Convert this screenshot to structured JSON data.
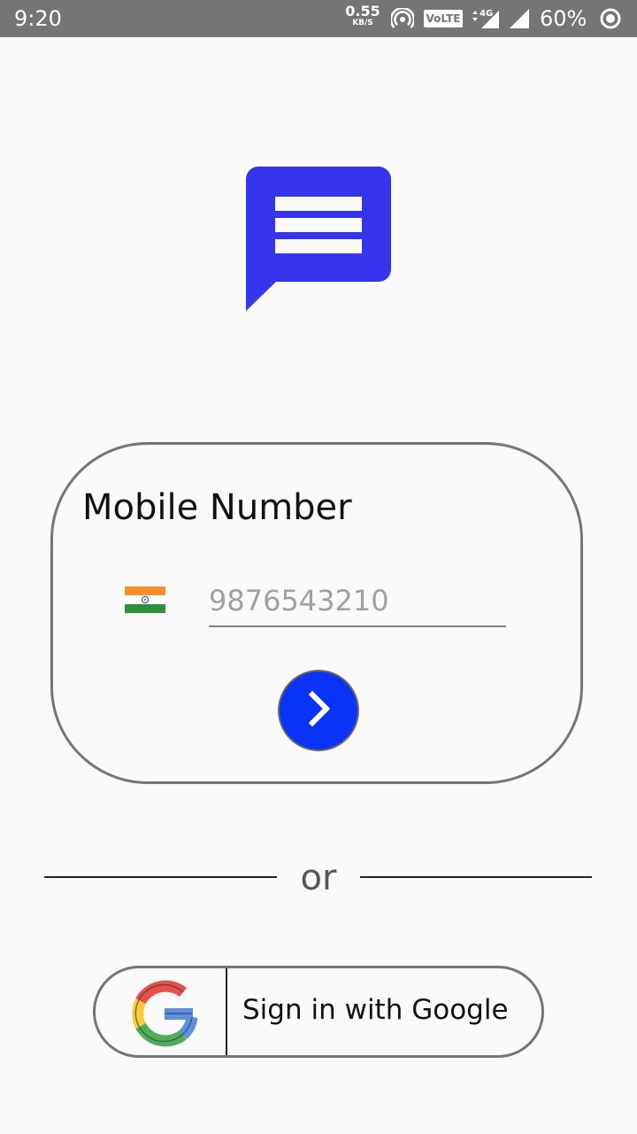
{
  "status_bar": {
    "time": "9:20",
    "net_speed_value": "0.55",
    "net_speed_unit": "KB/S",
    "volte_label": "VoLTE",
    "network_label": "4G",
    "battery_percent": "60%",
    "icons": [
      "hotspot-icon",
      "signal-4g-icon",
      "signal-icon",
      "battery-icon"
    ]
  },
  "app": {
    "logo_icon": "chat-bubble-icon",
    "brand_color": "#3535ee"
  },
  "login_card": {
    "title": "Mobile Number",
    "country_flag": "india-flag-icon",
    "phone_placeholder": "9876543210",
    "phone_value": "",
    "next_icon": "chevron-right-icon",
    "next_color": "#0a34f5"
  },
  "divider": {
    "text": "or"
  },
  "google_signin": {
    "label": "Sign in with Google",
    "icon": "google-g-icon"
  }
}
